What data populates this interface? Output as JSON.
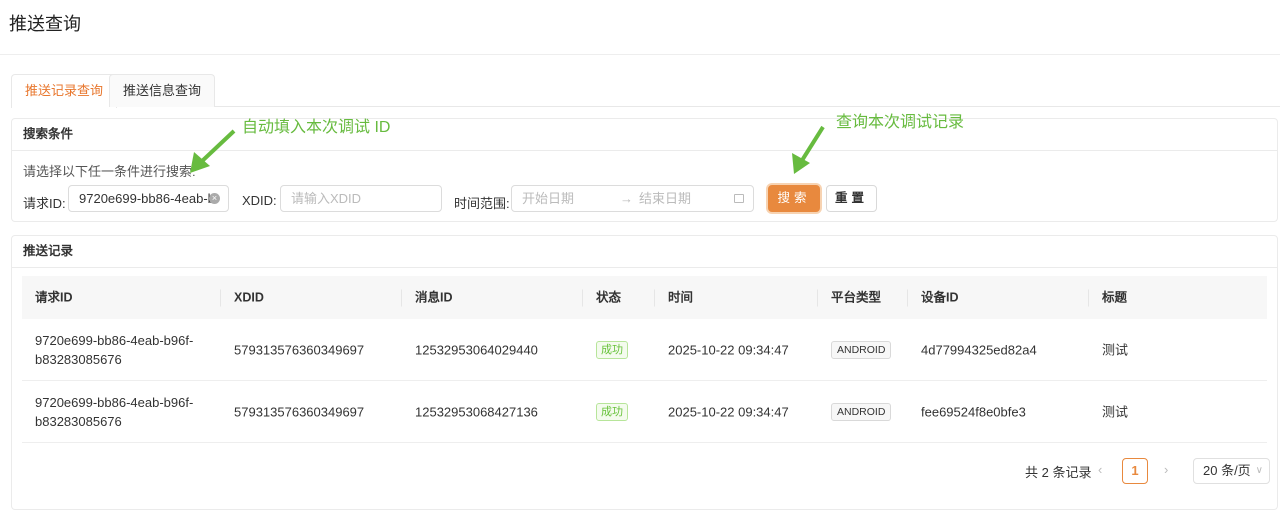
{
  "page": {
    "title": "推送查询"
  },
  "tabs": [
    {
      "label": "推送记录查询",
      "active": true
    },
    {
      "label": "推送信息查询",
      "active": false
    }
  ],
  "search": {
    "header": "搜索条件",
    "hint": "请选择以下任一条件进行搜索:",
    "request_id_label": "请求ID:",
    "request_id_value": "9720e699-bb86-4eab-b",
    "xdid_label": "XDID:",
    "xdid_placeholder": "请输入XDID",
    "time_label": "时间范围:",
    "start_placeholder": "开始日期",
    "end_placeholder": "结束日期",
    "search_button": "搜索",
    "reset_button": "重置",
    "accent": "#e8893e"
  },
  "annotations": {
    "a1": "自动填入本次调试 ID",
    "a2": "查询本次调试记录",
    "color": "#67bb3f"
  },
  "records": {
    "header": "推送记录",
    "columns": [
      "请求ID",
      "XDID",
      "消息ID",
      "状态",
      "时间",
      "平台类型",
      "设备ID",
      "标题"
    ],
    "rows": [
      {
        "request_id_1": "9720e699-bb86-4eab-b96f-",
        "request_id_2": "b83283085676",
        "xdid": "579313576360349697",
        "msg_id": "12532953064029440",
        "status": "成功",
        "time": "2025-10-22 09:34:47",
        "platform": "ANDROID",
        "device": "4d77994325ed82a4",
        "title": "测试"
      },
      {
        "request_id_1": "9720e699-bb86-4eab-b96f-",
        "request_id_2": "b83283085676",
        "xdid": "579313576360349697",
        "msg_id": "12532953068427136",
        "status": "成功",
        "time": "2025-10-22 09:34:47",
        "platform": "ANDROID",
        "device": "fee69524f8e0bfe3",
        "title": "测试"
      }
    ]
  },
  "pagination": {
    "total": "共 2 条记录",
    "current": "1",
    "page_size": "20 条/页"
  }
}
